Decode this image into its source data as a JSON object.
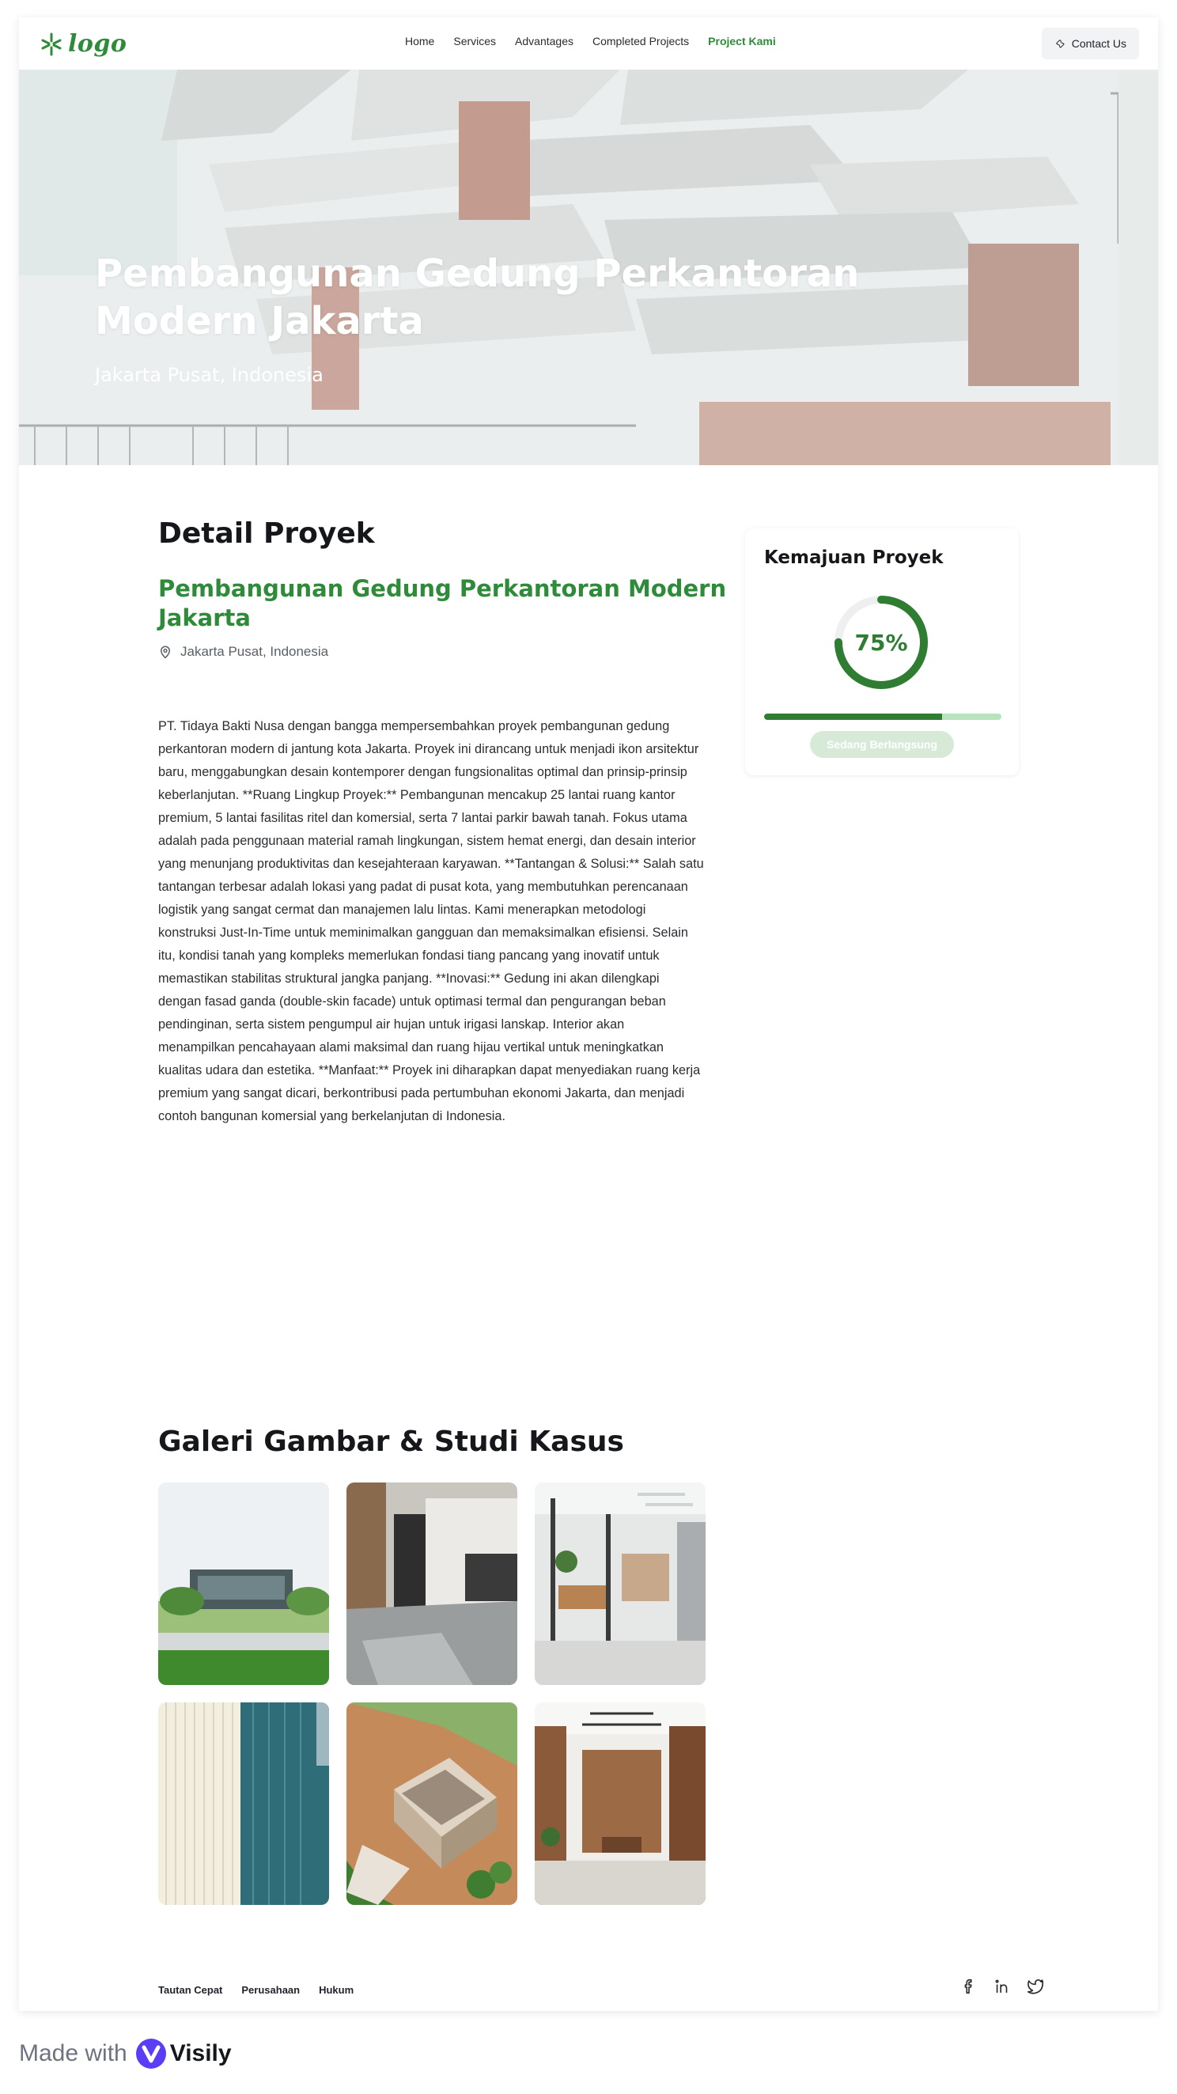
{
  "nav": {
    "logo_text": "logo",
    "items": [
      {
        "label": "Home"
      },
      {
        "label": "Services"
      },
      {
        "label": "Advantages"
      },
      {
        "label": "Completed Projects"
      },
      {
        "label": "Project Kami",
        "active": true
      }
    ],
    "contact_label": "Contact Us",
    "contact_icon": "wrench-icon"
  },
  "hero": {
    "title": "Pembangunan Gedung Perkantoran Modern Jakarta",
    "subtitle": "Jakarta Pusat, Indonesia"
  },
  "detail": {
    "heading": "Detail Proyek",
    "project_name": "Pembangunan Gedung Perkantoran Modern Jakarta",
    "location": "Jakarta Pusat, Indonesia",
    "location_icon": "map-pin-icon",
    "description": "PT. Tidaya Bakti Nusa dengan bangga mempersembahkan proyek pembangunan gedung perkantoran modern di jantung kota Jakarta. Proyek ini dirancang untuk menjadi ikon arsitektur baru, menggabungkan desain kontemporer dengan fungsionalitas optimal dan prinsip-prinsip keberlanjutan. **Ruang Lingkup Proyek:** Pembangunan mencakup 25 lantai ruang kantor premium, 5 lantai fasilitas ritel dan komersial, serta 7 lantai parkir bawah tanah. Fokus utama adalah pada penggunaan material ramah lingkungan, sistem hemat energi, dan desain interior yang menunjang produktivitas dan kesejahteraan karyawan. **Tantangan & Solusi:** Salah satu tantangan terbesar adalah lokasi yang padat di pusat kota, yang membutuhkan perencanaan logistik yang sangat cermat dan manajemen lalu lintas. Kami menerapkan metodologi konstruksi Just-In-Time untuk meminimalkan gangguan dan memaksimalkan efisiensi. Selain itu, kondisi tanah yang kompleks memerlukan fondasi tiang pancang yang inovatif untuk memastikan stabilitas struktural jangka panjang. **Inovasi:** Gedung ini akan dilengkapi dengan fasad ganda (double-skin facade) untuk optimasi termal dan pengurangan beban pendinginan, serta sistem pengumpul air hujan untuk irigasi lanskap. Interior akan menampilkan pencahayaan alami maksimal dan ruang hijau vertikal untuk meningkatkan kualitas udara dan estetika. **Manfaat:** Proyek ini diharapkan dapat menyediakan ruang kerja premium yang sangat dicari, berkontribusi pada pertumbuhan ekonomi Jakarta, dan menjadi contoh bangunan komersial yang berkelanjutan di Indonesia."
  },
  "progress": {
    "title": "Kemajuan Proyek",
    "percent": 75,
    "percent_label": "75%",
    "status": "Sedang Berlangsung",
    "color_fill": "#2e7d32",
    "color_track": "#b9e3bd"
  },
  "gallery": {
    "heading": "Galeri Gambar & Studi Kasus",
    "images": [
      {
        "subject": "office-building-exterior"
      },
      {
        "subject": "lobby-corridor"
      },
      {
        "subject": "open-office-interior"
      },
      {
        "subject": "glass-facade"
      },
      {
        "subject": "aerial-construction-site"
      },
      {
        "subject": "wood-paneled-lobby"
      }
    ]
  },
  "footer": {
    "links": [
      "Tautan Cepat",
      "Perusahaan",
      "Hukum"
    ],
    "social_icons": [
      "facebook-icon",
      "linkedin-icon",
      "twitter-icon"
    ]
  },
  "watermark": {
    "made_with": "Made with",
    "brand": "Visily"
  },
  "colors": {
    "accent": "#2e8b3a",
    "text": "#15171a"
  }
}
